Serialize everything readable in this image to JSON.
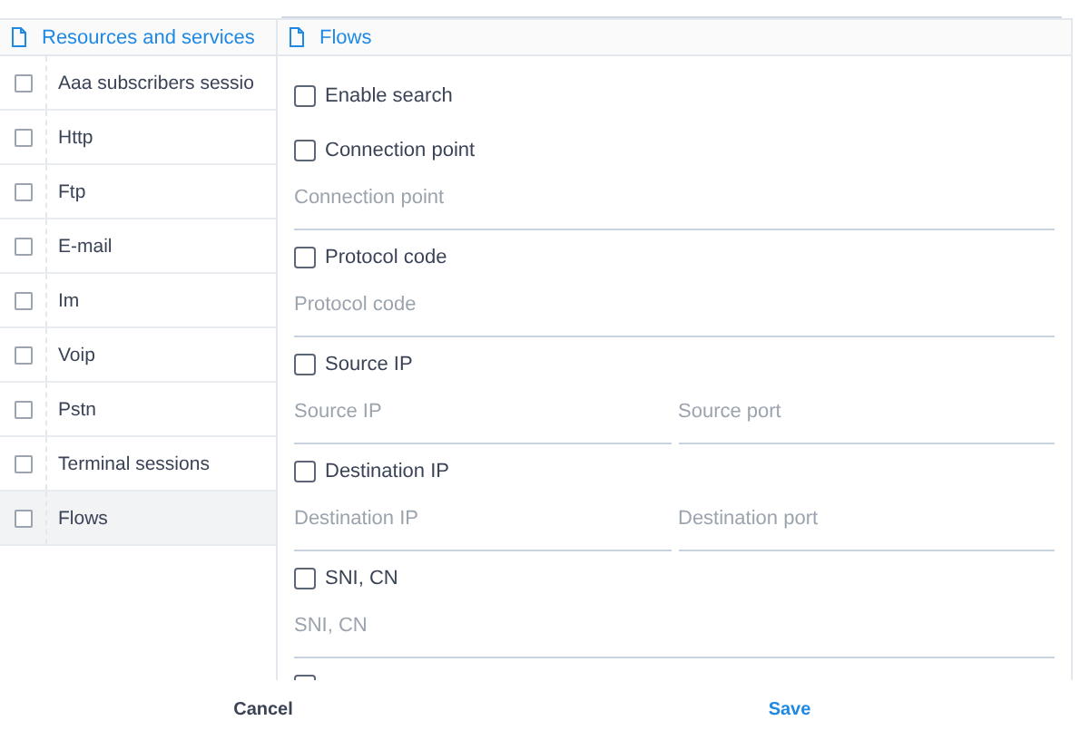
{
  "left_panel": {
    "title": "Resources and services",
    "items": [
      {
        "label": "Aaa subscribers sessio",
        "checked": false,
        "selected": false
      },
      {
        "label": "Http",
        "checked": false,
        "selected": false
      },
      {
        "label": "Ftp",
        "checked": false,
        "selected": false
      },
      {
        "label": "E-mail",
        "checked": false,
        "selected": false
      },
      {
        "label": "Im",
        "checked": false,
        "selected": false
      },
      {
        "label": "Voip",
        "checked": false,
        "selected": false
      },
      {
        "label": "Pstn",
        "checked": false,
        "selected": false
      },
      {
        "label": "Terminal sessions",
        "checked": false,
        "selected": false
      },
      {
        "label": "Flows",
        "checked": false,
        "selected": true
      }
    ]
  },
  "right_panel": {
    "title": "Flows",
    "items": [
      {
        "kind": "checkbox",
        "label": "Enable search",
        "checked": false
      },
      {
        "kind": "checkbox",
        "label": "Connection point",
        "checked": false
      },
      {
        "kind": "fields",
        "placeholders": [
          "Connection point"
        ]
      },
      {
        "kind": "checkbox",
        "label": "Protocol code",
        "checked": false
      },
      {
        "kind": "fields",
        "placeholders": [
          "Protocol code"
        ]
      },
      {
        "kind": "checkbox",
        "label": "Source IP",
        "checked": false
      },
      {
        "kind": "fields",
        "placeholders": [
          "Source IP",
          "Source port"
        ]
      },
      {
        "kind": "checkbox",
        "label": "Destination IP",
        "checked": false
      },
      {
        "kind": "fields",
        "placeholders": [
          "Destination IP",
          "Destination port"
        ]
      },
      {
        "kind": "checkbox",
        "label": "SNI, CN",
        "checked": false
      },
      {
        "kind": "fields",
        "placeholders": [
          "SNI, CN"
        ]
      },
      {
        "kind": "checkbox",
        "checked": false
      }
    ]
  },
  "footer": {
    "buttons": [
      {
        "label": "Cancel",
        "kind": "secondary"
      },
      {
        "label": "Save",
        "kind": "primary"
      }
    ]
  }
}
